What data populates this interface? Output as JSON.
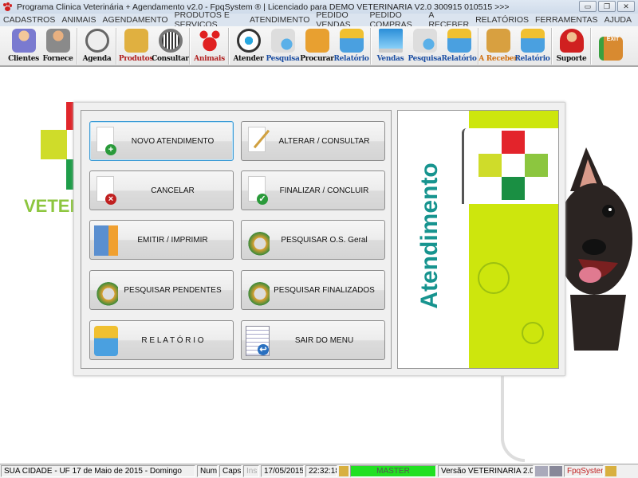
{
  "window": {
    "title": "Programa Clinica Veterinária + Agendamento v2.0 - FpqSystem ® | Licenciado para  DEMO VETERINARIA V2.0 300915 010515 >>>",
    "minimize": "▭",
    "restore": "❐",
    "close": "✕"
  },
  "menu": [
    "CADASTROS",
    "ANIMAIS",
    "AGENDAMENTO",
    "PRODUTOS E SERVIÇOS",
    "ATENDIMENTO",
    "PEDIDO VENDAS",
    "PEDIDO COMPRAS",
    "A RECEBER",
    "RELATÓRIOS",
    "FERRAMENTAS",
    "AJUDA"
  ],
  "toolbar": {
    "clientes": "Clientes",
    "fornece": "Fornece",
    "agenda": "Agenda",
    "produtos": "Produtos",
    "consultar": "Consultar",
    "animais": "Animais",
    "atender": "Atender",
    "pesquisa1": "Pesquisa",
    "procurar": "Procurar",
    "relatorio1": "Relatório",
    "vendas": "Vendas",
    "pesquisa2": "Pesquisa",
    "relatorio2": "Relatório",
    "areceber": "A Receber",
    "relatorio3": "Relatório",
    "suporte": "Suporte",
    "exit": "EXIT"
  },
  "background": {
    "logo_text": "VETERINARIA"
  },
  "dialog": {
    "buttons": [
      "NOVO ATENDIMENTO",
      "ALTERAR  /  CONSULTAR",
      "CANCELAR",
      "FINALIZAR  /  CONCLUIR",
      "EMITIR  /  IMPRIMIR",
      "PESQUISAR O.S. Geral",
      "PESQUISAR PENDENTES",
      "PESQUISAR FINALIZADOS",
      "R E L A T Ó R I O",
      "SAIR DO MENU"
    ],
    "side_title": "Atendimento"
  },
  "status": {
    "city": "SUA CIDADE - UF 17 de Maio de 2015 - Domingo",
    "num": "Num",
    "caps": "Caps",
    "ins": "Ins",
    "date": "17/05/2015",
    "time": "22:32:18",
    "user": "MASTER",
    "version": "Versão VETERINARIA 2.0",
    "brand": "FpqSystem"
  },
  "colors": {
    "accent_lime": "#cde60d",
    "title_teal": "#17948f",
    "status_green": "#22e022"
  }
}
